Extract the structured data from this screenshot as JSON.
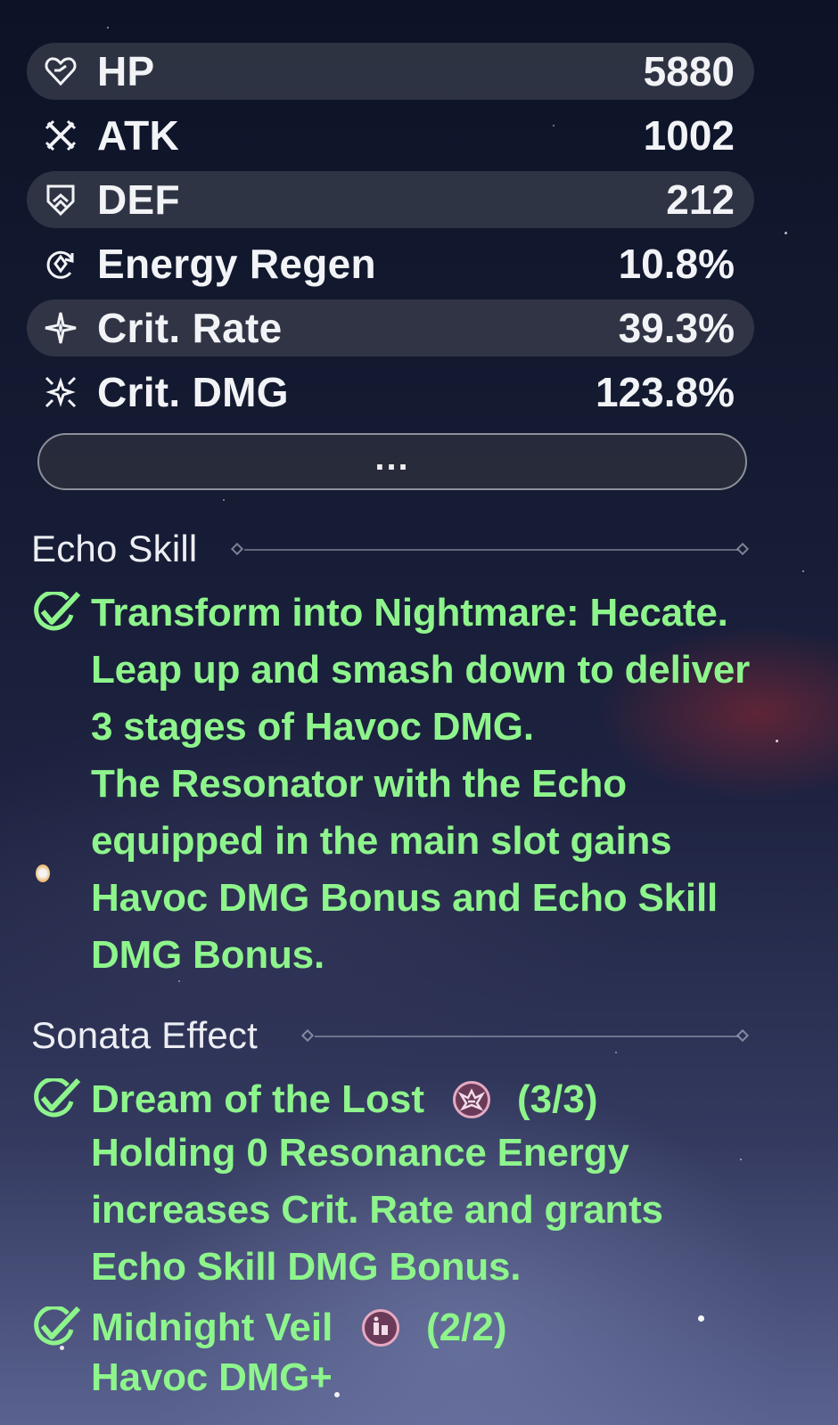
{
  "stats": [
    {
      "label": "HP",
      "value": "5880",
      "icon": "heart-icon"
    },
    {
      "label": "ATK",
      "value": "1002",
      "icon": "crossed-swords-icon"
    },
    {
      "label": "DEF",
      "value": "212",
      "icon": "shield-icon"
    },
    {
      "label": "Energy Regen",
      "value": "10.8%",
      "icon": "energy-regen-icon"
    },
    {
      "label": "Crit. Rate",
      "value": "39.3%",
      "icon": "crit-rate-star-icon"
    },
    {
      "label": "Crit. DMG",
      "value": "123.8%",
      "icon": "crit-dmg-burst-icon"
    }
  ],
  "more_button": {
    "label": "..."
  },
  "echo_skill": {
    "title": "Echo Skill",
    "lines": [
      "Transform into Nightmare: Hecate.",
      "Leap up and smash down to deliver",
      "3 stages of Havoc DMG.",
      "The Resonator with the Echo",
      "equipped in the main slot gains",
      "Havoc DMG Bonus and Echo Skill",
      "DMG Bonus."
    ]
  },
  "sonata_effect": {
    "title": "Sonata Effect",
    "sets": [
      {
        "name": "Dream of the Lost",
        "count": "(3/3)",
        "icon": "dream-of-the-lost-set-icon",
        "lines": [
          "Holding 0 Resonance Energy",
          "increases Crit. Rate and grants",
          "Echo Skill DMG Bonus."
        ]
      },
      {
        "name": "Midnight Veil",
        "count": "(2/2)",
        "icon": "midnight-veil-set-icon",
        "lines": [
          "Havoc DMG+"
        ]
      }
    ]
  },
  "colors": {
    "effect_text": "#8ef48c",
    "stat_text": "#f2f3f6",
    "row_shade": "#3c404e",
    "set_badge_border": "#e7a9c2"
  }
}
